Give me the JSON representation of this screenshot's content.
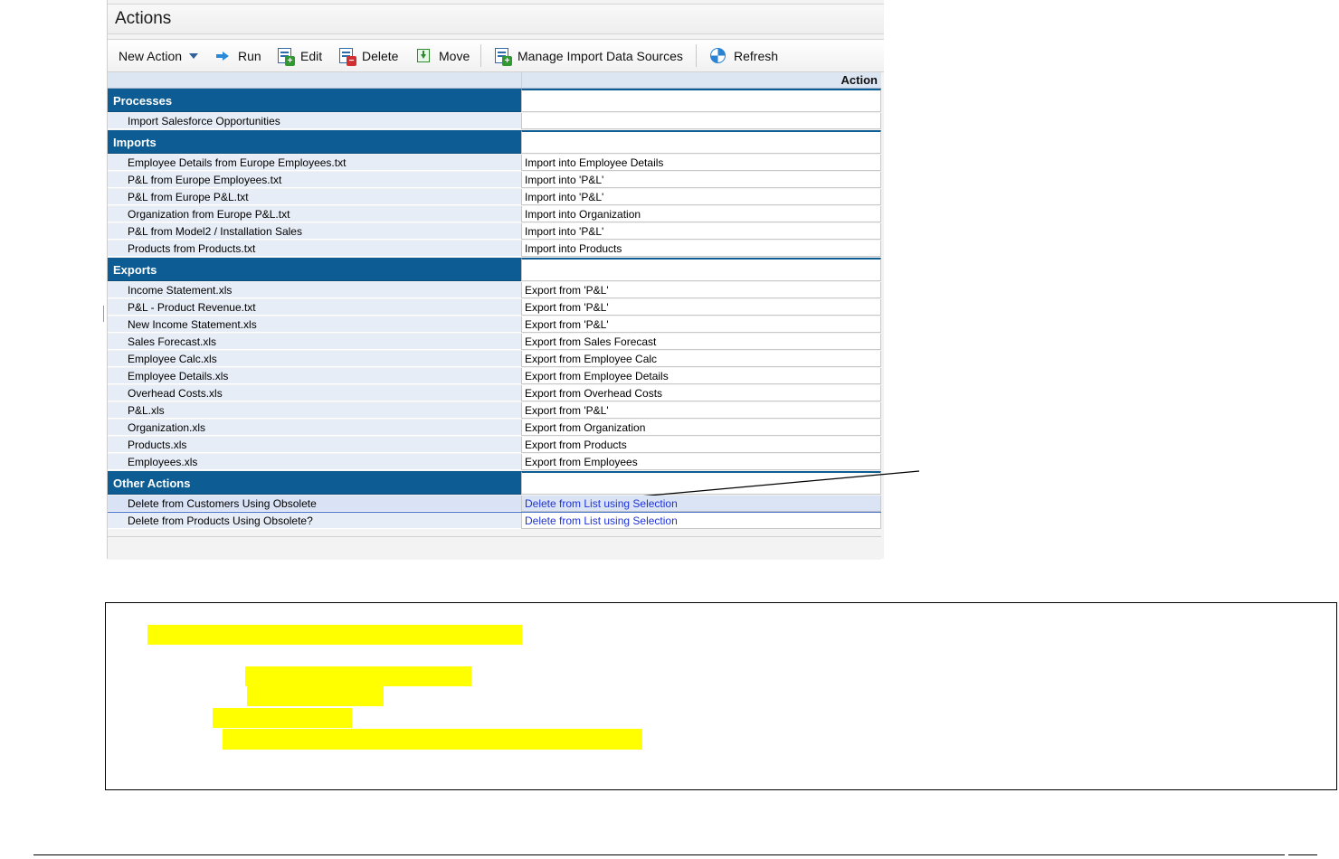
{
  "window": {
    "title": "Actions"
  },
  "toolbar": {
    "new_action": "New Action",
    "run": "Run",
    "edit": "Edit",
    "delete": "Delete",
    "move": "Move",
    "manage_import": "Manage Import Data Sources",
    "refresh": "Refresh"
  },
  "grid": {
    "header_action": "Action",
    "groups": {
      "processes": {
        "label": "Processes",
        "rows": [
          {
            "name": "Import Salesforce Opportunities",
            "action": ""
          }
        ]
      },
      "imports": {
        "label": "Imports",
        "rows": [
          {
            "name": "Employee Details from Europe Employees.txt",
            "action": "Import into Employee Details"
          },
          {
            "name": "P&L from Europe Employees.txt",
            "action": "Import into 'P&L'"
          },
          {
            "name": "P&L from Europe P&L.txt",
            "action": "Import into 'P&L'"
          },
          {
            "name": "Organization from Europe P&L.txt",
            "action": "Import into Organization"
          },
          {
            "name": "P&L from Model2 / Installation Sales",
            "action": "Import into 'P&L'"
          },
          {
            "name": "Products from Products.txt",
            "action": "Import into Products"
          }
        ]
      },
      "exports": {
        "label": "Exports",
        "rows": [
          {
            "name": "Income Statement.xls",
            "action": "Export from 'P&L'"
          },
          {
            "name": "P&L - Product Revenue.txt",
            "action": "Export from 'P&L'"
          },
          {
            "name": "New Income Statement.xls",
            "action": "Export from 'P&L'"
          },
          {
            "name": "Sales Forecast.xls",
            "action": "Export from Sales Forecast"
          },
          {
            "name": "Employee Calc.xls",
            "action": "Export from Employee Calc"
          },
          {
            "name": "Employee Details.xls",
            "action": "Export from Employee Details"
          },
          {
            "name": "Overhead Costs.xls",
            "action": "Export from Overhead Costs"
          },
          {
            "name": "P&L.xls",
            "action": "Export from 'P&L'"
          },
          {
            "name": "Organization.xls",
            "action": "Export from Organization"
          },
          {
            "name": "Products.xls",
            "action": "Export from Products"
          },
          {
            "name": "Employees.xls",
            "action": "Export from Employees"
          }
        ]
      },
      "other": {
        "label": "Other Actions",
        "rows": [
          {
            "name": "Delete from Customers Using Obsolete",
            "action": "Delete from List using Selection"
          },
          {
            "name": "Delete from Products Using Obsolete?",
            "action": "Delete from List using Selection"
          }
        ]
      }
    }
  },
  "colors": {
    "group_header_bg": "#0d5c94",
    "link_text": "#1f33d6",
    "highlight": "#ffff00",
    "selection_outline": "#3a68c8"
  },
  "icons": {
    "new_action_caret": "chevron-down-icon",
    "run": "arrow-right-icon",
    "edit": "edit-document-icon",
    "delete": "delete-document-icon",
    "move": "move-down-icon",
    "manage_import": "data-source-icon",
    "refresh": "refresh-icon"
  }
}
